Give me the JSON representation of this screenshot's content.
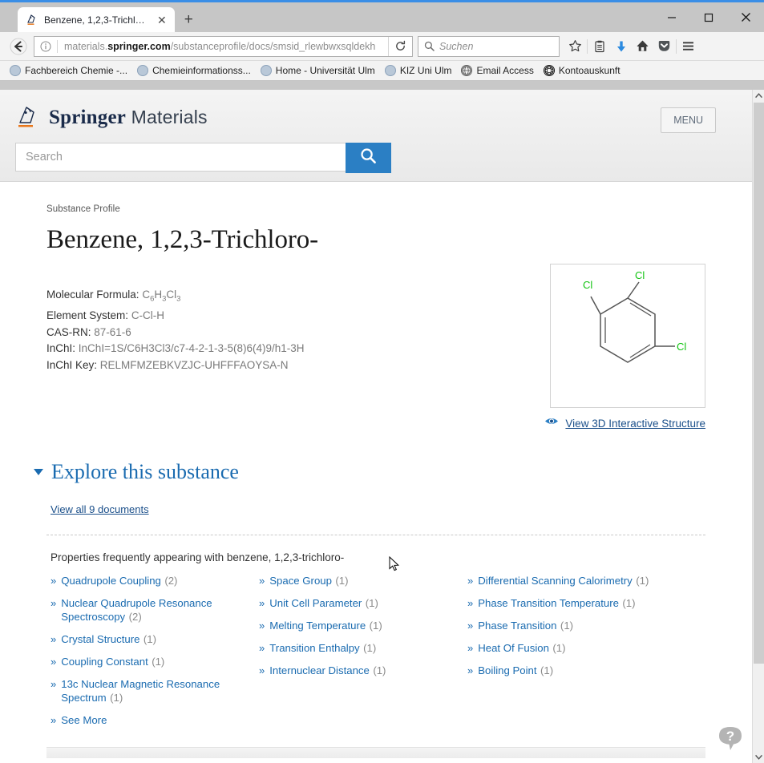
{
  "browser": {
    "tab": {
      "title": "Benzene, 1,2,3-Trichloro- ...",
      "favicon_name": "springer-favicon",
      "close_label": "✕"
    },
    "new_tab_label": "+",
    "window_controls": {
      "minimize": "—",
      "maximize": "☐",
      "close": "✕"
    },
    "nav": {
      "back_label": "←",
      "url_prefix": "materials.",
      "url_domain": "springer.com",
      "url_path": "/substanceprofile/docs/smsid_rlewbwxsqldekh",
      "reload_label": "↻",
      "search_placeholder": "Suchen"
    },
    "toolbar_icons": [
      {
        "name": "bookmark-star-icon",
        "glyph": "☆"
      },
      {
        "name": "reading-list-icon",
        "glyph": "▤"
      },
      {
        "name": "downloads-icon",
        "glyph": "⬇"
      },
      {
        "name": "home-icon",
        "glyph": "⌂"
      },
      {
        "name": "pocket-icon",
        "glyph": "⬇"
      },
      {
        "name": "hamburger-menu-icon",
        "glyph": "≡"
      }
    ],
    "bookmarks": [
      {
        "label": "Fachbereich Chemie -...",
        "icon": "globe-bookmark-icon"
      },
      {
        "label": "Chemieinformationss...",
        "icon": "globe-bookmark-icon"
      },
      {
        "label": "Home - Universität Ulm",
        "icon": "globe-bookmark-icon"
      },
      {
        "label": "KIZ Uni Ulm",
        "icon": "globe-bookmark-icon"
      },
      {
        "label": "Email Access",
        "icon": "world-globe-icon"
      },
      {
        "label": "Kontoauskunft",
        "icon": "dark-globe-icon"
      }
    ]
  },
  "site": {
    "brand_bold": "Springer",
    "brand_light": " Materials",
    "menu_label": "MENU",
    "search_placeholder": "Search",
    "search_button_name": "search-icon"
  },
  "page": {
    "kicker": "Substance Profile",
    "title": "Benzene, 1,2,3-Trichloro-",
    "facts": [
      {
        "label": "Molecular Formula:",
        "value": "C6H3Cl3",
        "html_value": "C<sub>6</sub>H<sub>3</sub>Cl<sub>3</sub>"
      },
      {
        "label": "Element System:",
        "value": "C-Cl-H"
      },
      {
        "label": "CAS-RN:",
        "value": "87-61-6"
      },
      {
        "label": "InChI:",
        "value": "InChI=1S/C6H3Cl3/c7-4-2-1-3-5(8)6(4)9/h1-3H"
      },
      {
        "label": "InChI Key:",
        "value": "RELMFMZEBKVZJC-UHFFFAOYSA-N"
      }
    ],
    "structure": {
      "atom_labels": [
        "Cl",
        "Cl",
        "Cl"
      ],
      "atom_color": "#12c412",
      "bond_color": "#555555"
    },
    "view3d_label": "View 3D Interactive Structure",
    "view3d_icon": "eye-icon",
    "explore_heading": "Explore this substance",
    "view_all_label": "View all 9 documents",
    "properties_intro": "Properties frequently appearing with benzene, 1,2,3-trichloro-",
    "columns": [
      [
        {
          "label": "Quadrupole Coupling",
          "count": "(2)"
        },
        {
          "label": "Nuclear Quadrupole Resonance Spectroscopy",
          "count": "(2)"
        },
        {
          "label": "Crystal Structure",
          "count": "(1)"
        },
        {
          "label": "Coupling Constant",
          "count": "(1)"
        },
        {
          "label": "13c Nuclear Magnetic Resonance Spectrum",
          "count": "(1)"
        }
      ],
      [
        {
          "label": "Space Group",
          "count": "(1)"
        },
        {
          "label": "Unit Cell Parameter",
          "count": "(1)"
        },
        {
          "label": "Melting Temperature",
          "count": "(1)"
        },
        {
          "label": "Transition Enthalpy",
          "count": "(1)"
        },
        {
          "label": "Internuclear Distance",
          "count": "(1)"
        }
      ],
      [
        {
          "label": "Differential Scanning Calorimetry",
          "count": "(1)"
        },
        {
          "label": "Phase Transition Temperature",
          "count": "(1)"
        },
        {
          "label": "Phase Transition",
          "count": "(1)"
        },
        {
          "label": "Heat Of Fusion",
          "count": "(1)"
        },
        {
          "label": "Boiling Point",
          "count": "(1)"
        }
      ]
    ],
    "see_more_label": "See More",
    "chevron_glyph": "»",
    "help_icon_name": "help-chat-icon",
    "help_glyph": "?"
  },
  "colors": {
    "link_blue": "#1a6bb0",
    "accent_blue": "#2b7fc4",
    "brand_navy": "#1a2b4a",
    "brand_orange": "#e8761a",
    "chlorine_green": "#12c412"
  }
}
